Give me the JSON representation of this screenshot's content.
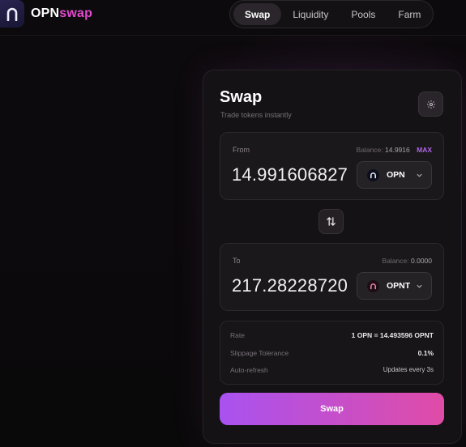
{
  "brand": {
    "name_part1": "OPN",
    "name_part2": "swap"
  },
  "nav": {
    "items": [
      "Swap",
      "Liquidity",
      "Pools",
      "Farm"
    ],
    "active": "Swap"
  },
  "card": {
    "title": "Swap",
    "subtitle": "Trade tokens instantly"
  },
  "from": {
    "label": "From",
    "balance_label": "Balance:",
    "balance_value": "14.9916",
    "max_label": "MAX",
    "amount": "14.991606827",
    "token": "OPN"
  },
  "to": {
    "label": "To",
    "balance_label": "Balance:",
    "balance_value": "0.0000",
    "amount": "217.28228720",
    "token": "OPNT"
  },
  "info": {
    "rate_label": "Rate",
    "rate_value": "1 OPN = 14.493596 OPNT",
    "slippage_label": "Slippage Tolerance",
    "slippage_value": "0.1%",
    "refresh_label": "Auto-refresh",
    "refresh_value": "Updates every 3s"
  },
  "swap_button": "Swap",
  "colors": {
    "accent_start": "#a952f0",
    "accent_end": "#e04ca7",
    "brand_pink": "#e24bd0"
  },
  "icons": [
    "logo-arch-icon",
    "gear-icon",
    "token-opn-icon",
    "token-opnt-icon",
    "chevron-down-icon",
    "swap-arrows-icon"
  ]
}
